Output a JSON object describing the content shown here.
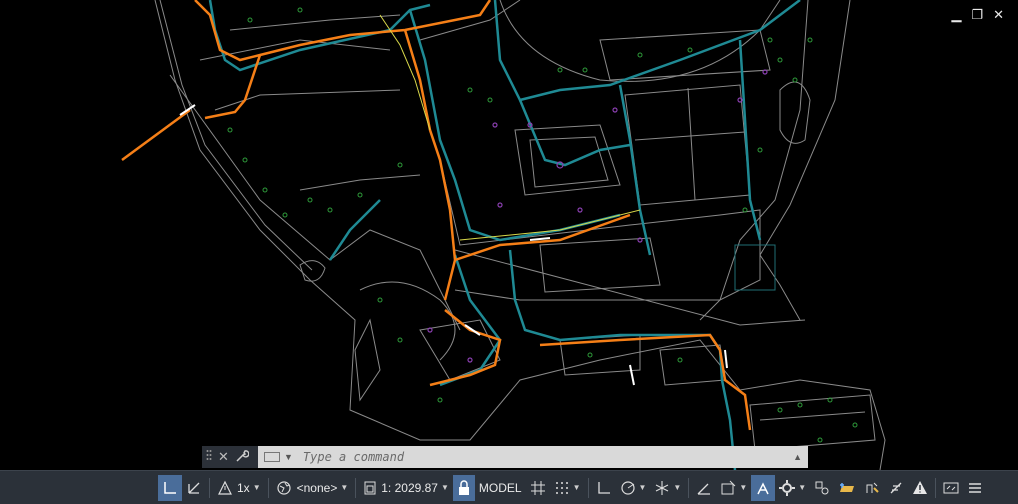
{
  "window": {
    "minimize_label": "▁",
    "restore_label": "❐",
    "close_label": "✕"
  },
  "command_line": {
    "close_label": "✕",
    "placeholder": "Type a command",
    "value": ""
  },
  "status_bar": {
    "annotation_scale": "1x",
    "ucs": "<none>",
    "viewport_scale": "1: 2029.87",
    "space": "MODEL"
  },
  "colors": {
    "background": "#000000",
    "statusbar": "#2b3139",
    "accent": "#4a6d9a",
    "orange_line": "#f57f17",
    "teal_line": "#1f8a94"
  },
  "icons": [
    "grip-icon",
    "close-icon",
    "wrench-icon",
    "command-prompt-icon",
    "snap-icon",
    "coordinate-icon",
    "warning-icon",
    "globe-icon",
    "viewport-icon",
    "lock-icon",
    "grid-icon",
    "dots-icon",
    "ortho-icon",
    "polar-icon",
    "isodraft-icon",
    "angle-icon",
    "rectangle-icon",
    "person-icon",
    "gear-icon",
    "layers-icon",
    "isolate-icon",
    "pencil-icon",
    "alert-icon",
    "fullscreen-icon",
    "menu-icon"
  ]
}
